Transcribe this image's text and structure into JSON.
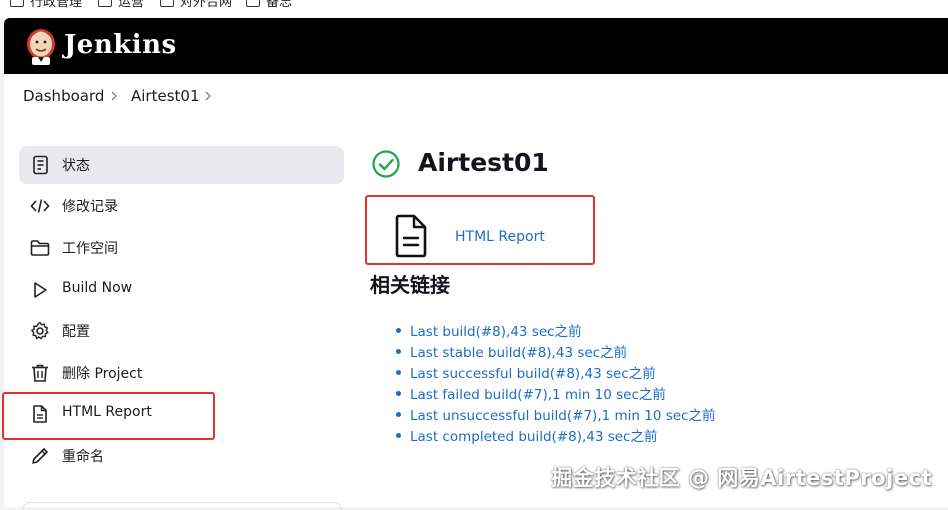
{
  "bookmarks_bar": {
    "items": [
      {
        "label": "行政管理"
      },
      {
        "label": "运营"
      },
      {
        "label": "对外合网"
      },
      {
        "label": "备忘"
      }
    ]
  },
  "header": {
    "brand": "Jenkins",
    "logo_icon": "jenkins-butler-icon"
  },
  "breadcrumb": {
    "items": [
      {
        "label": "Dashboard"
      },
      {
        "label": "Airtest01"
      }
    ]
  },
  "sidebar": {
    "items": [
      {
        "label": "状态",
        "icon": "notepad-icon",
        "active": true
      },
      {
        "label": "修改记录",
        "icon": "code-icon",
        "active": false
      },
      {
        "label": "工作空间",
        "icon": "folder-icon",
        "active": false
      },
      {
        "label": "Build Now",
        "icon": "play-icon",
        "active": false
      },
      {
        "label": "配置",
        "icon": "gear-icon",
        "active": false
      },
      {
        "label": "删除 Project",
        "icon": "trash-icon",
        "active": false
      },
      {
        "label": "HTML Report",
        "icon": "document-icon",
        "active": false
      },
      {
        "label": "重命名",
        "icon": "pencil-icon",
        "active": false
      }
    ]
  },
  "main": {
    "title": "Airtest01",
    "status_icon": "success-check-icon",
    "report_link": "HTML Report",
    "related_links_title": "相关链接",
    "related_links": [
      "Last build(#8),43 sec之前",
      "Last stable build(#8),43 sec之前",
      "Last successful build(#8),43 sec之前",
      "Last failed build(#7),1 min 10 sec之前",
      "Last unsuccessful build(#7),1 min 10 sec之前",
      "Last completed build(#8),43 sec之前"
    ]
  },
  "watermark": "掘金技术社区 @ 网易AirtestProject",
  "colors": {
    "link": "#1c6cc6",
    "highlight_box": "#e8302a",
    "success": "#1ea64b",
    "header_bg": "#000000"
  }
}
